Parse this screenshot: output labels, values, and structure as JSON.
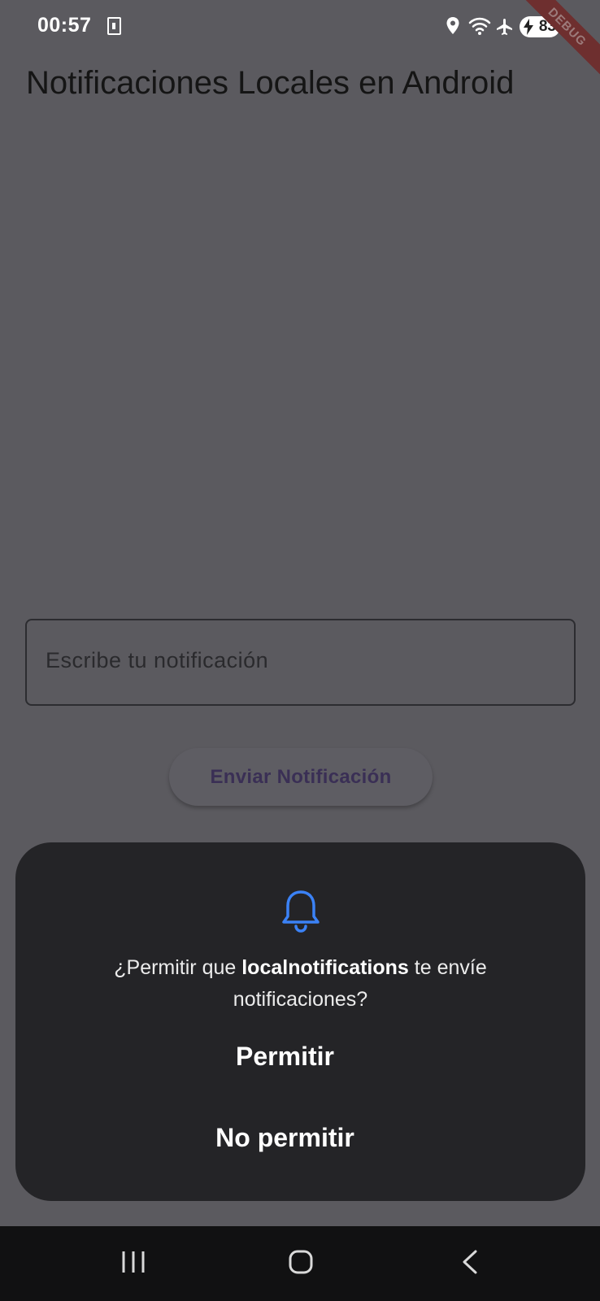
{
  "status_bar": {
    "time": "00:57",
    "battery_level": "83",
    "icons": [
      "sim-icon",
      "location-icon",
      "wifi-icon",
      "airplane-icon",
      "battery-charging-icon"
    ]
  },
  "debug_banner": "DEBUG",
  "app": {
    "title": "Notificaciones Locales en Android",
    "input": {
      "placeholder": "Escribe tu notificación",
      "value": ""
    },
    "send_button": "Enviar Notificación"
  },
  "permission_dialog": {
    "icon": "bell-icon",
    "message_prefix": "¿Permitir que ",
    "app_name": "localnotifications",
    "message_suffix": " te envíe notificaciones?",
    "allow_button": "Permitir",
    "deny_button": "No permitir"
  },
  "nav_bar": {
    "items": [
      "recent-apps-icon",
      "home-icon",
      "back-icon"
    ]
  },
  "colors": {
    "scrim_background": "#5b5a5f",
    "dialog_background": "#242427",
    "accent_blue": "#3b82f6",
    "button_text": "#3a2f55"
  }
}
